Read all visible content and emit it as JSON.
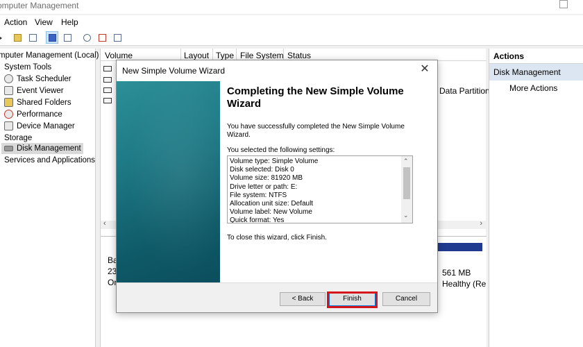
{
  "window": {
    "title": "omputer Management"
  },
  "menu": [
    "Action",
    "View",
    "Help"
  ],
  "tree": {
    "root": "mputer Management (Local)",
    "items": [
      {
        "label": "System Tools",
        "indent": false,
        "icon": ""
      },
      {
        "label": "Task Scheduler",
        "indent": true,
        "icon": "clock-icon"
      },
      {
        "label": "Event Viewer",
        "indent": true,
        "icon": "event-viewer-icon"
      },
      {
        "label": "Shared Folders",
        "indent": true,
        "icon": "shared-folders-icon"
      },
      {
        "label": "Performance",
        "indent": true,
        "icon": "performance-icon"
      },
      {
        "label": "Device Manager",
        "indent": true,
        "icon": "device-manager-icon"
      },
      {
        "label": "Storage",
        "indent": false,
        "icon": ""
      },
      {
        "label": "Disk Management",
        "indent": true,
        "icon": "disk-icon",
        "selected": true
      },
      {
        "label": "Services and Applications",
        "indent": false,
        "icon": ""
      }
    ]
  },
  "columns": [
    "Volume",
    "Layout",
    "Type",
    "File System",
    "Status"
  ],
  "volume_status_fragment": "Data Partition",
  "graphical": {
    "left_lines": [
      "Ba",
      "23",
      "On"
    ],
    "right_lines": [
      "561 MB",
      "Healthy (Re"
    ]
  },
  "actions": {
    "header": "Actions",
    "section": "Disk Management",
    "more": "More Actions"
  },
  "wizard": {
    "title": "New Simple Volume Wizard",
    "heading": "Completing the New Simple Volume Wizard",
    "success_text": "You have successfully completed the New Simple Volume Wizard.",
    "settings_label": "You selected the following settings:",
    "settings": [
      "Volume type: Simple Volume",
      "Disk selected: Disk 0",
      "Volume size: 81920 MB",
      "Drive letter or path: E:",
      "File system: NTFS",
      "Allocation unit size: Default",
      "Volume label: New Volume",
      "Quick format: Yes"
    ],
    "close_text": "To close this wizard, click Finish.",
    "buttons": {
      "back": "< Back",
      "finish": "Finish",
      "cancel": "Cancel"
    }
  },
  "colors": {
    "highlight": "#d7141a",
    "banner": "#1e7a86",
    "disk_bar": "#1f3a8f"
  }
}
